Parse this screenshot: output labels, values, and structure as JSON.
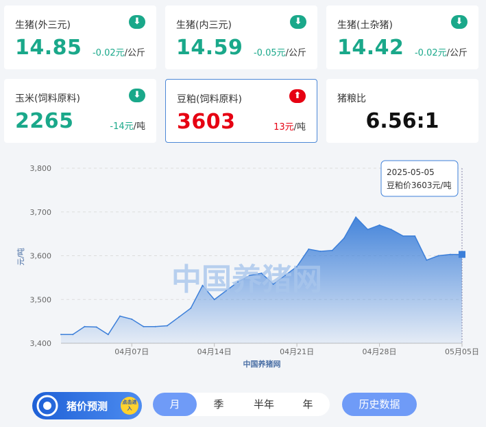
{
  "cards": [
    {
      "name": "生猪(外三元)",
      "value": "14.85",
      "change": "-0.02元",
      "unit": "/公斤",
      "trend": "down"
    },
    {
      "name": "生猪(内三元)",
      "value": "14.59",
      "change": "-0.05元",
      "unit": "/公斤",
      "trend": "down"
    },
    {
      "name": "生猪(土杂猪)",
      "value": "14.42",
      "change": "-0.02元",
      "unit": "/公斤",
      "trend": "down"
    },
    {
      "name": "玉米(饲料原料)",
      "value": "2265",
      "change": "-14元",
      "unit": "/吨",
      "trend": "down"
    },
    {
      "name": "豆粕(饲料原料)",
      "value": "3603",
      "change": "13元",
      "unit": "/吨",
      "trend": "up"
    },
    {
      "name": "猪粮比",
      "value": "6.56:1"
    }
  ],
  "chart_data": {
    "type": "area",
    "ylabel": "元/吨",
    "xlabel": "中国养猪网",
    "watermark": "中国养猪网",
    "ylim": [
      3400,
      3800
    ],
    "yticks": [
      "3,400",
      "3,500",
      "3,600",
      "3,700",
      "3,800"
    ],
    "xticks": [
      {
        "day": 6,
        "label": "04月07日"
      },
      {
        "day": 13,
        "label": "04月14日"
      },
      {
        "day": 20,
        "label": "04月21日"
      },
      {
        "day": 27,
        "label": "04月28日"
      },
      {
        "day": 34,
        "label": "05月05日"
      }
    ],
    "series": [
      {
        "dates": [
          "04-01",
          "04-02",
          "04-03",
          "04-04",
          "04-05",
          "04-06",
          "04-07",
          "04-08",
          "04-09",
          "04-10",
          "04-11",
          "04-12",
          "04-13",
          "04-14",
          "04-15",
          "04-16",
          "04-17",
          "04-18",
          "04-19",
          "04-20",
          "04-21",
          "04-22",
          "04-23",
          "04-24",
          "04-25",
          "04-26",
          "04-27",
          "04-28",
          "04-29",
          "04-30",
          "05-01",
          "05-02",
          "05-03",
          "05-04",
          "05-05"
        ],
        "values": [
          3420,
          3420,
          3438,
          3437,
          3420,
          3462,
          3455,
          3438,
          3438,
          3440,
          3460,
          3480,
          3532,
          3500,
          3520,
          3540,
          3555,
          3560,
          3535,
          3555,
          3575,
          3615,
          3610,
          3612,
          3640,
          3688,
          3660,
          3670,
          3660,
          3645,
          3645,
          3590,
          3600,
          3603,
          3603
        ]
      }
    ],
    "tooltip": {
      "date": "2025-05-05",
      "label": "豆粕价3603元/吨"
    },
    "grid": true
  },
  "colors": {
    "down": "#1aa88a",
    "up": "#e60012",
    "accent": "#6f9bf7",
    "line": "#3c7fd9"
  },
  "promo": {
    "text": "猪价预测",
    "tag": "点击进入"
  },
  "period_tabs": [
    "月",
    "季",
    "半年",
    "年"
  ],
  "active_period": "月",
  "history_button": "历史数据"
}
